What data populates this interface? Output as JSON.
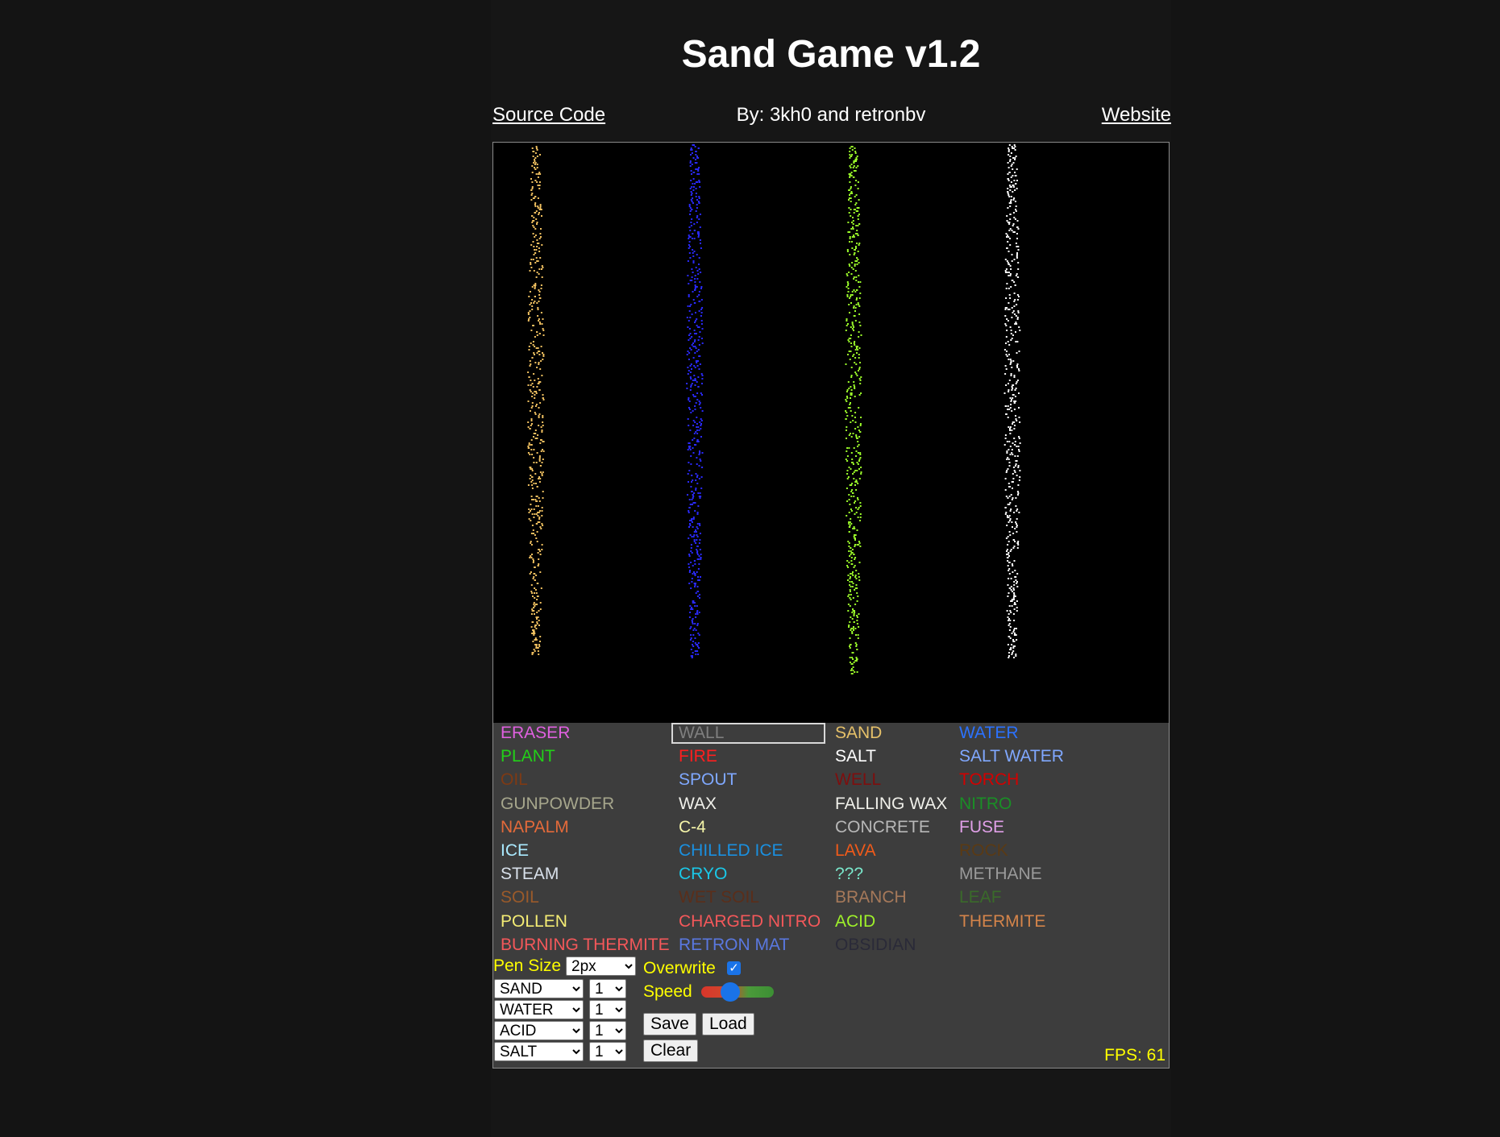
{
  "page": {
    "title": "Sand Game v1.2"
  },
  "header": {
    "source_link": "Source Code",
    "byline": "By: 3kh0 and retronbv",
    "website_link": "Website"
  },
  "streams": [
    {
      "name": "sand-stream",
      "color": "#f0c060"
    },
    {
      "name": "water-stream",
      "color": "#2a2aff"
    },
    {
      "name": "acid-stream",
      "color": "#9cff2a"
    },
    {
      "name": "salt-stream",
      "color": "#ffffff"
    }
  ],
  "elements": [
    {
      "label": "ERASER",
      "color": "#e060e0"
    },
    {
      "label": "WALL",
      "color": "#7f7f7f",
      "selected": true
    },
    {
      "label": "SAND",
      "color": "#e5c069"
    },
    {
      "label": "WATER",
      "color": "#2b72ff"
    },
    {
      "label": "PLANT",
      "color": "#22d018"
    },
    {
      "label": "FIRE",
      "color": "#ff1e1e"
    },
    {
      "label": "SALT",
      "color": "#ffffff"
    },
    {
      "label": "SALT WATER",
      "color": "#80a8ff"
    },
    {
      "label": "OIL",
      "color": "#7e3a14"
    },
    {
      "label": "SPOUT",
      "color": "#7fa8ff"
    },
    {
      "label": "WELL",
      "color": "#7e0e0e"
    },
    {
      "label": "TORCH",
      "color": "#d30000"
    },
    {
      "label": "GUNPOWDER",
      "color": "#a6a68c"
    },
    {
      "label": "WAX",
      "color": "#f0f0ea"
    },
    {
      "label": "FALLING WAX",
      "color": "#f0f0ea"
    },
    {
      "label": "NITRO",
      "color": "#1a8f26"
    },
    {
      "label": "NAPALM",
      "color": "#e46a3a"
    },
    {
      "label": "C-4",
      "color": "#f4f4a8"
    },
    {
      "label": "CONCRETE",
      "color": "#b8b8b8"
    },
    {
      "label": "FUSE",
      "color": "#e0a0e8"
    },
    {
      "label": "ICE",
      "color": "#aaeaff"
    },
    {
      "label": "CHILLED ICE",
      "color": "#1a90e0"
    },
    {
      "label": "LAVA",
      "color": "#f05a1a"
    },
    {
      "label": "ROCK",
      "color": "#5a3a14"
    },
    {
      "label": "STEAM",
      "color": "#d8e0ea"
    },
    {
      "label": "CRYO",
      "color": "#1ac8e8"
    },
    {
      "label": "???",
      "color": "#7ae8cc"
    },
    {
      "label": "METHANE",
      "color": "#9a9a9a"
    },
    {
      "label": "SOIL",
      "color": "#9a5a2a"
    },
    {
      "label": "WET SOIL",
      "color": "#5a2e1a"
    },
    {
      "label": "BRANCH",
      "color": "#a6795a"
    },
    {
      "label": "LEAF",
      "color": "#3a6a2a"
    },
    {
      "label": "POLLEN",
      "color": "#f4ec74"
    },
    {
      "label": "CHARGED NITRO",
      "color": "#f4585a"
    },
    {
      "label": "ACID",
      "color": "#9ef02a"
    },
    {
      "label": "THERMITE",
      "color": "#d4844a"
    },
    {
      "label": "BURNING THERMITE",
      "color": "#f4585a"
    },
    {
      "label": "RETRON MAT",
      "color": "#5a78e0"
    },
    {
      "label": "OBSIDIAN",
      "color": "#2a2a38"
    }
  ],
  "controls": {
    "pen_size_label": "Pen Size",
    "pen_size_value": "2px",
    "overwrite_label": "Overwrite",
    "overwrite_checked": true,
    "overwrite_check_glyph": "✓",
    "speed_label": "Speed",
    "speed_value": 0.4,
    "spawners": [
      {
        "element": "SAND",
        "count": "1"
      },
      {
        "element": "WATER",
        "count": "1"
      },
      {
        "element": "ACID",
        "count": "1"
      },
      {
        "element": "SALT",
        "count": "1"
      }
    ],
    "save_label": "Save",
    "load_label": "Load",
    "clear_label": "Clear"
  },
  "status": {
    "fps": "FPS: 61"
  }
}
